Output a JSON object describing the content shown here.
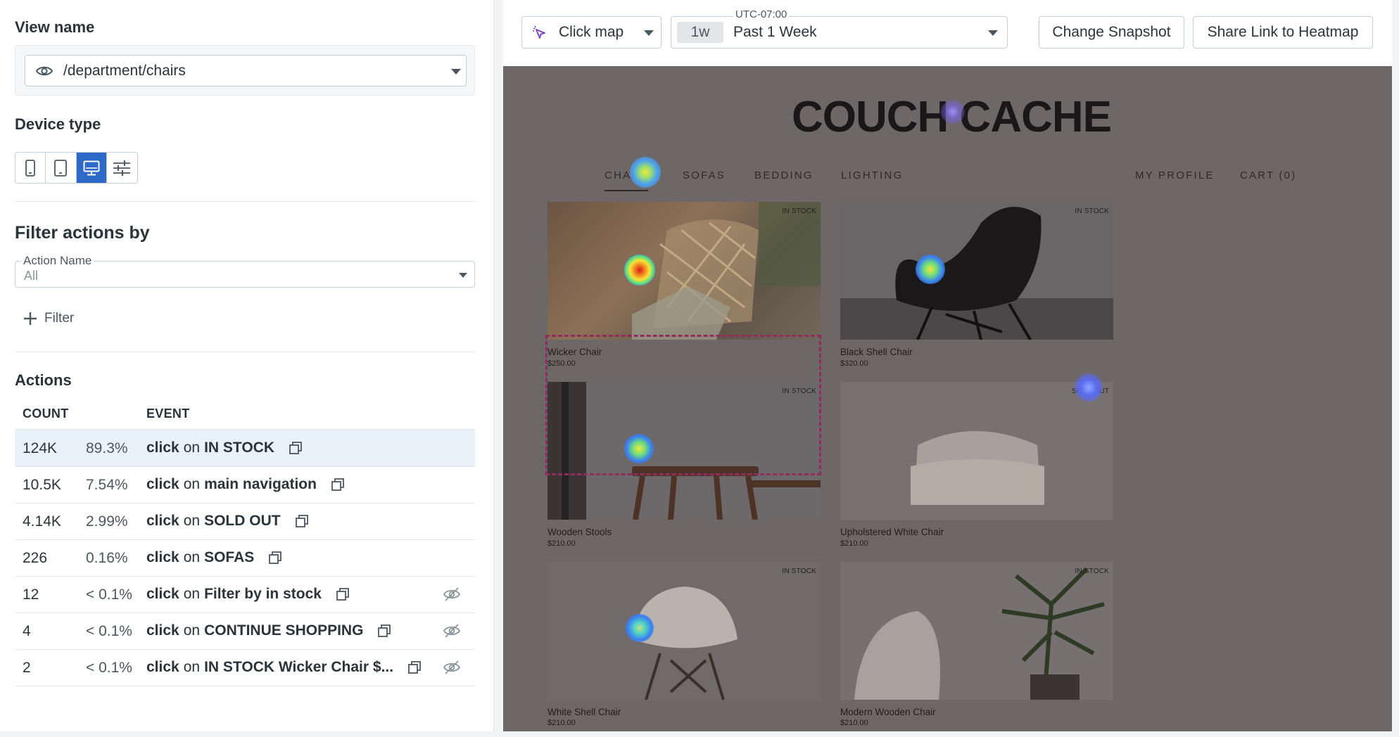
{
  "left_panel": {
    "view_name": {
      "heading": "View name",
      "value": "/department/chairs"
    },
    "device_type": {
      "heading": "Device type",
      "options": [
        "mobile",
        "tablet",
        "desktop",
        "custom"
      ],
      "selected": "desktop"
    },
    "filter": {
      "heading": "Filter actions by",
      "action_name_label": "Action Name",
      "action_name_value": "All",
      "add_filter_label": "Filter"
    },
    "actions": {
      "heading": "Actions",
      "columns": [
        "COUNT",
        "EVENT"
      ],
      "rows": [
        {
          "count": "124K",
          "pct": "89.3%",
          "verb": "click",
          "prep": "on",
          "target": "IN STOCK",
          "hidden_icon": false,
          "selected": true
        },
        {
          "count": "10.5K",
          "pct": "7.54%",
          "verb": "click",
          "prep": "on",
          "target": "main navigation",
          "hidden_icon": false,
          "selected": false
        },
        {
          "count": "4.14K",
          "pct": "2.99%",
          "verb": "click",
          "prep": "on",
          "target": "SOLD OUT",
          "hidden_icon": false,
          "selected": false
        },
        {
          "count": "226",
          "pct": "0.16%",
          "verb": "click",
          "prep": "on",
          "target": "SOFAS",
          "hidden_icon": false,
          "selected": false
        },
        {
          "count": "12",
          "pct": "< 0.1%",
          "verb": "click",
          "prep": "on",
          "target": "Filter by in stock",
          "hidden_icon": true,
          "selected": false
        },
        {
          "count": "4",
          "pct": "< 0.1%",
          "verb": "click",
          "prep": "on",
          "target": "CONTINUE SHOPPING",
          "hidden_icon": true,
          "selected": false
        },
        {
          "count": "2",
          "pct": "< 0.1%",
          "verb": "click",
          "prep": "on",
          "target": "IN STOCK Wicker Chair $...",
          "hidden_icon": true,
          "selected": false
        }
      ]
    }
  },
  "toolbar": {
    "map_type": "Click map",
    "timezone": "UTC-07:00",
    "range_badge": "1w",
    "range_label": "Past 1 Week",
    "change_snapshot": "Change Snapshot",
    "share_link": "Share Link to Heatmap"
  },
  "site": {
    "logo": "COUCH CACHE",
    "nav": [
      "CHAIRS",
      "SOFAS",
      "BEDDING",
      "LIGHTING"
    ],
    "nav_right": [
      "MY PROFILE",
      "CART (0)"
    ],
    "products": [
      {
        "name": "Wicker Chair",
        "price": "$250.00",
        "tag": "IN STOCK"
      },
      {
        "name": "Black Shell Chair",
        "price": "$320.00",
        "tag": "IN STOCK"
      },
      {
        "name": "Wooden Stools",
        "price": "$210.00",
        "tag": "IN STOCK"
      },
      {
        "name": "Upholstered White Chair",
        "price": "$210.00",
        "tag": "SOLD OUT"
      },
      {
        "name": "White Shell Chair",
        "price": "$210.00",
        "tag": "IN STOCK"
      },
      {
        "name": "Modern Wooden Chair",
        "price": "$210.00",
        "tag": "IN STOCK"
      }
    ]
  },
  "colors": {
    "accent": "#2d69c6",
    "selection": "#e9f1f9",
    "highlight_border": "#8f2e5c",
    "overlay": "#6e6767"
  },
  "icons": [
    "eye-icon",
    "caret-down-icon",
    "mobile-icon",
    "tablet-icon",
    "desktop-icon",
    "sliders-icon",
    "plus-icon",
    "copy-icon",
    "eye-off-icon",
    "cursor-click-icon"
  ]
}
